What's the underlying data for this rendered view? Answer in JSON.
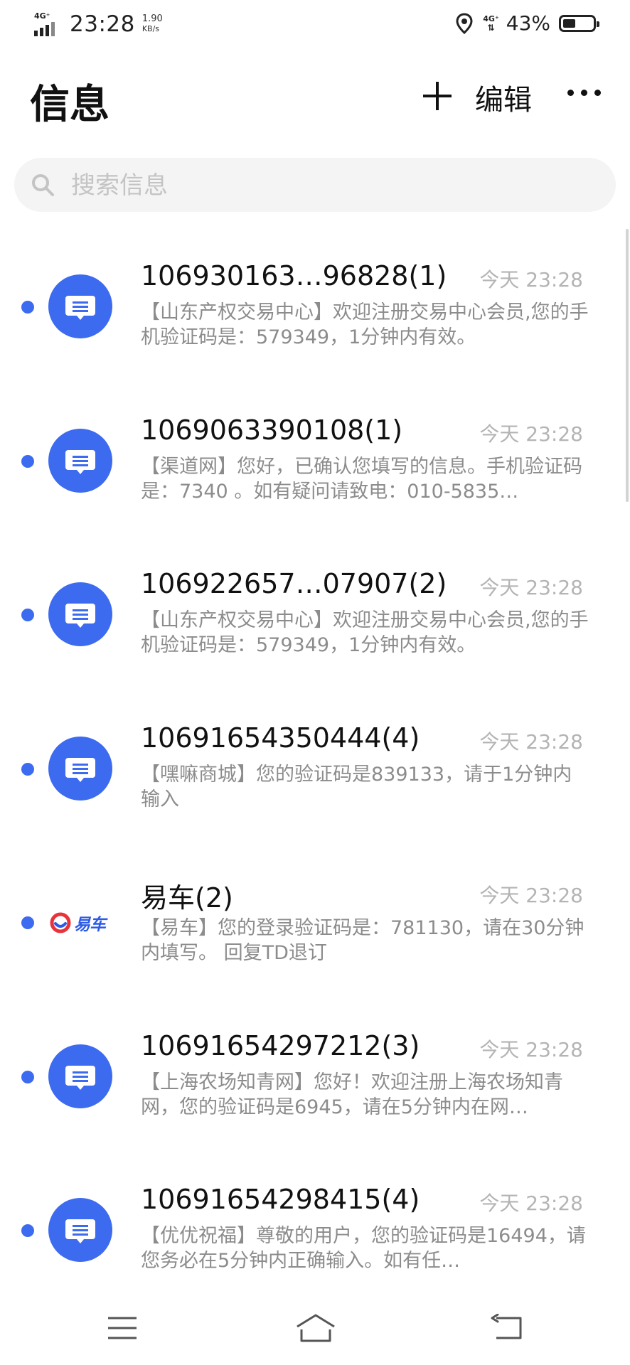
{
  "status_bar": {
    "network_left": "4G⁺",
    "time": "23:28",
    "speed_value": "1.90",
    "speed_unit": "KB/s",
    "network_right": "4G⁺",
    "battery_percent": "43%",
    "battery_level": 0.43,
    "icons": [
      "signal-icon",
      "location-icon",
      "battery-icon"
    ]
  },
  "header": {
    "title": "信息",
    "edit_label": "编辑",
    "icons": [
      "add-icon",
      "more-icon"
    ]
  },
  "search": {
    "placeholder": "搜索信息",
    "icon": "search-icon"
  },
  "colors": {
    "accent": "#3d6bf0",
    "muted_text": "#8c8c8c",
    "time_text": "#b4b4b4"
  },
  "messages": [
    {
      "sender": "106930163…96828(1)",
      "time": "今天 23:28",
      "preview": "【山东产权交易中心】欢迎注册交易中心会员,您的手机验证码是：579349，1分钟内有效。",
      "avatar": "message-icon",
      "unread": true
    },
    {
      "sender": "1069063390108(1)",
      "time": "今天 23:28",
      "preview": "【渠道网】您好，已确认您填写的信息。手机验证码是：7340 。如有疑问请致电：010-5835…",
      "avatar": "message-icon",
      "unread": true
    },
    {
      "sender": "106922657…07907(2)",
      "time": "今天 23:28",
      "preview": "【山东产权交易中心】欢迎注册交易中心会员,您的手机验证码是：579349，1分钟内有效。",
      "avatar": "message-icon",
      "unread": true
    },
    {
      "sender": "10691654350444(4)",
      "time": "今天 23:28",
      "preview": "【嘿嘛商城】您的验证码是839133，请于1分钟内输入",
      "avatar": "message-icon",
      "unread": true
    },
    {
      "sender": "易车(2)",
      "time": "今天 23:28",
      "preview": "【易车】您的登录验证码是：781130，请在30分钟内填写。 回复TD退订",
      "avatar": "yiche-logo",
      "avatar_text": "易车",
      "unread": true
    },
    {
      "sender": "10691654297212(3)",
      "time": "今天 23:28",
      "preview": "【上海农场知青网】您好！欢迎注册上海农场知青网，您的验证码是6945，请在5分钟内在网…",
      "avatar": "message-icon",
      "unread": true
    },
    {
      "sender": "10691654298415(4)",
      "time": "今天 23:28",
      "preview": "【优优祝福】尊敬的用户，您的验证码是16494，请您务必在5分钟内正确输入。如有任…",
      "avatar": "message-icon",
      "unread": true
    }
  ],
  "nav": {
    "icons": [
      "menu-icon",
      "home-icon",
      "back-icon"
    ]
  }
}
